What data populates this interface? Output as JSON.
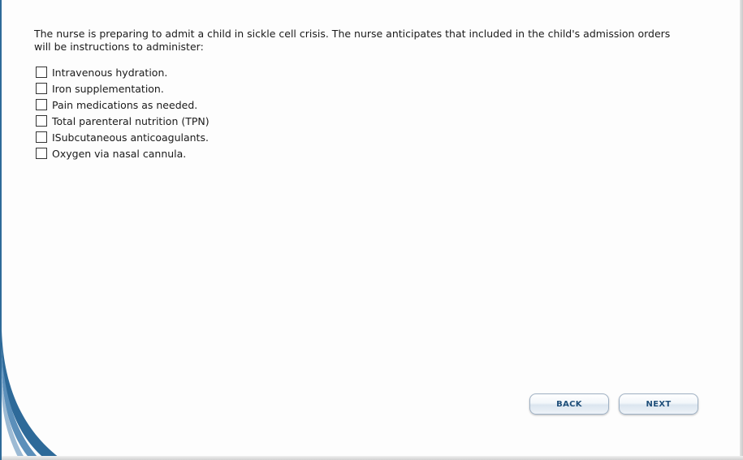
{
  "question": {
    "text": "The nurse is preparing to admit a child in sickle cell crisis. The nurse anticipates that included in the child's admission orders will be instructions to administer:"
  },
  "options": [
    {
      "label": "Intravenous hydration.",
      "checked": false
    },
    {
      "label": "Iron supplementation.",
      "checked": false
    },
    {
      "label": "Pain medications as needed.",
      "checked": false
    },
    {
      "label": "Total parenteral nutrition (TPN)",
      "checked": false
    },
    {
      "label": "ISubcutaneous anticoagulants.",
      "checked": false
    },
    {
      "label": "Oxygen via nasal cannula.",
      "checked": false
    }
  ],
  "navigation": {
    "back_label": "BACK",
    "next_label": "NEXT"
  },
  "colors": {
    "accent": "#2e6a99",
    "button_text": "#1f4f7a"
  }
}
